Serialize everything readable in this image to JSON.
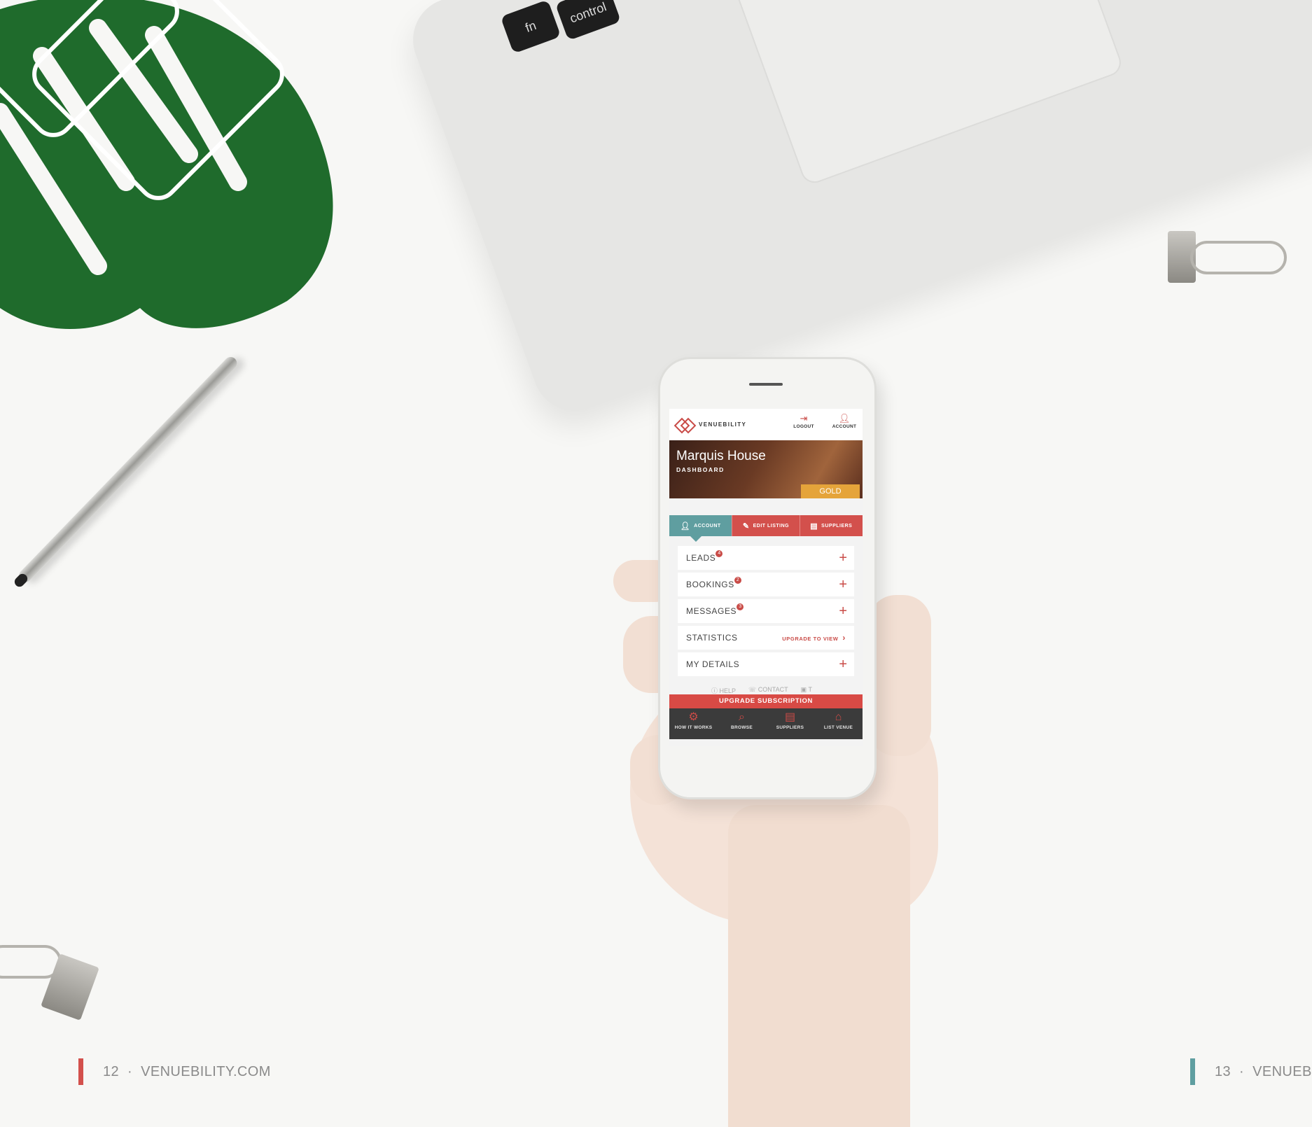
{
  "laptop": {
    "keys": [
      "fn",
      "control"
    ]
  },
  "app": {
    "brand": "VENUEBILITY",
    "header_buttons": [
      {
        "label": "LOGOUT",
        "icon": "logout-icon"
      },
      {
        "label": "ACCOUNT",
        "icon": "user-icon"
      }
    ],
    "venue_name": "Marquis House",
    "section": "DASHBOARD",
    "tier": "GOLD",
    "tabs": [
      {
        "label": "ACCOUNT",
        "icon": "user-icon",
        "active": true
      },
      {
        "label": "EDIT LISTING",
        "icon": "edit-icon",
        "active": false
      },
      {
        "label": "SUPPLIERS",
        "icon": "document-icon",
        "active": false
      }
    ],
    "menu": [
      {
        "label": "LEADS",
        "badge": "4",
        "action": "+"
      },
      {
        "label": "BOOKINGS",
        "badge": "2",
        "action": "+"
      },
      {
        "label": "MESSAGES",
        "badge": "3",
        "action": "+"
      },
      {
        "label": "STATISTICS",
        "badge": "",
        "action_text": "UPGRADE TO VIEW"
      },
      {
        "label": "MY DETAILS",
        "badge": "",
        "action": "+"
      }
    ],
    "footer_links": [
      "HELP",
      "CONTACT",
      "T"
    ],
    "upgrade_bar": "UPGRADE SUBSCRIPTION",
    "bottom_nav": [
      {
        "label": "HOW IT WORKS",
        "icon": "gear-icon"
      },
      {
        "label": "BROWSE",
        "icon": "search-icon"
      },
      {
        "label": "SUPPLIERS",
        "icon": "document-icon"
      },
      {
        "label": "LIST VENUE",
        "icon": "building-icon"
      }
    ]
  },
  "footer": {
    "left_page": "12",
    "left_site": "VENUEBILITY.COM",
    "right_page": "13",
    "right_site": "VENUEB",
    "separator": "·"
  },
  "colors": {
    "accent_red": "#d3504c",
    "accent_teal": "#5f9ea0",
    "gold": "#e5a43a",
    "dark_nav": "#3b3b3b"
  }
}
